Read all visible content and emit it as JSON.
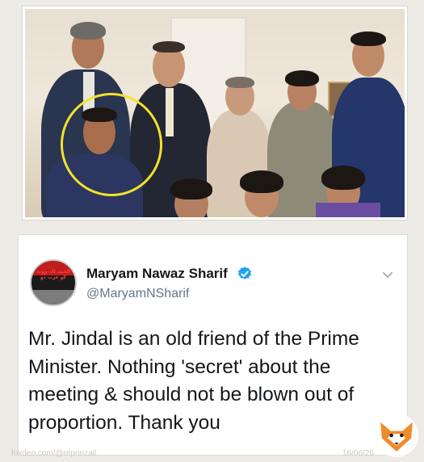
{
  "photo": {
    "alt_icon": "group-photo",
    "highlight_color": "#f2e22a"
  },
  "tweet": {
    "display_name": "Maryam Nawaz Sharif",
    "handle": "@MaryamNSharif",
    "verified": true,
    "text": "Mr. Jindal is an old friend of the Prime Minister. Nothing 'secret' about the meeting & should not be blown out of proportion. Thank you",
    "avatar_text": "الحمد للہ ووٹ کو عزت دو",
    "menu_icon": "chevron-down-icon"
  },
  "watermark": {
    "site": "foxdeo.com/@reponzall",
    "date": "16/06/26",
    "logo": "fox-logo-icon"
  },
  "colors": {
    "verified_blue": "#1da1f2",
    "name_text": "#14171a",
    "handle_text": "#657786"
  }
}
